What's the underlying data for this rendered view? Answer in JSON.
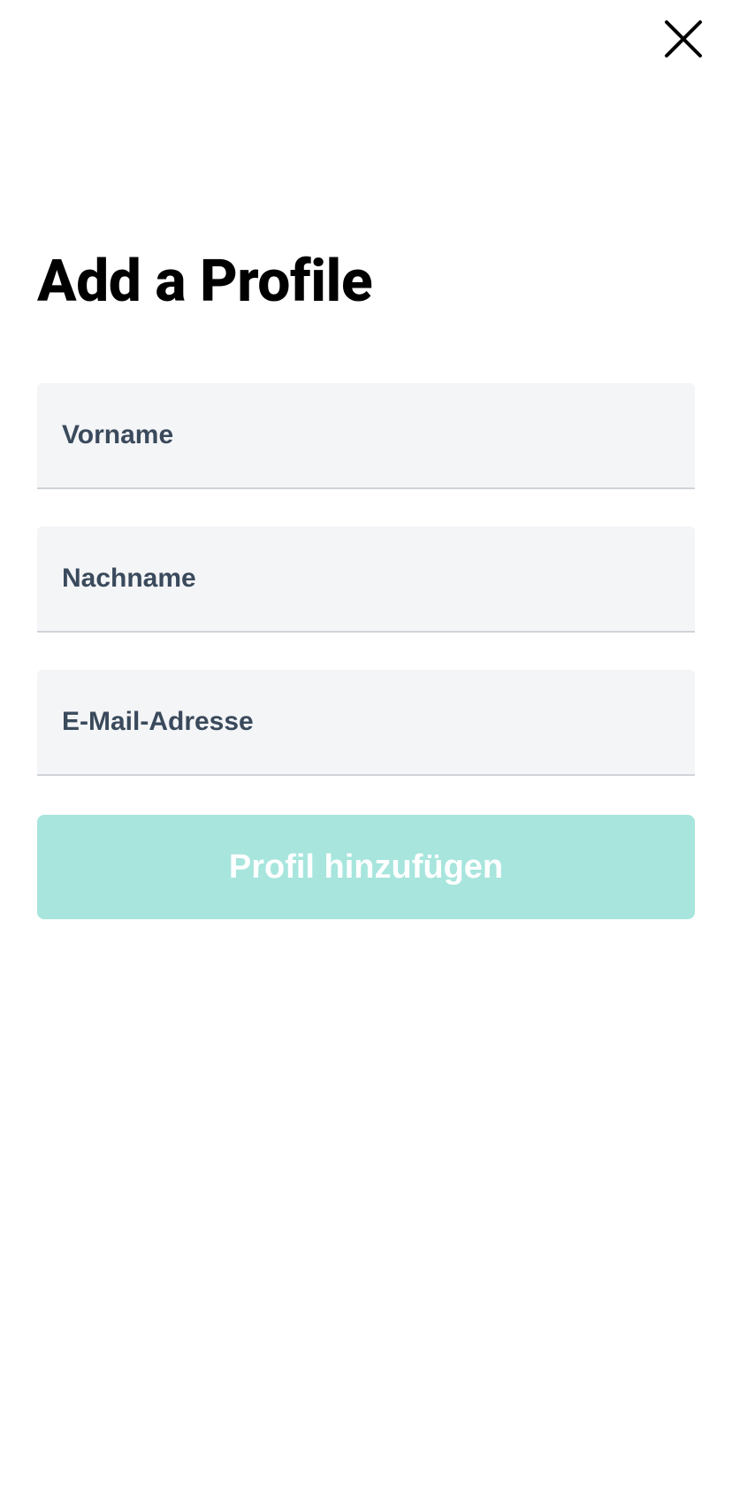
{
  "header": {
    "title": "Add a Profile"
  },
  "form": {
    "fields": {
      "first_name": {
        "placeholder": "Vorname",
        "value": ""
      },
      "last_name": {
        "placeholder": "Nachname",
        "value": ""
      },
      "email": {
        "placeholder": "E-Mail-Adresse",
        "value": ""
      }
    },
    "submit_label": "Profil hinzufügen"
  }
}
